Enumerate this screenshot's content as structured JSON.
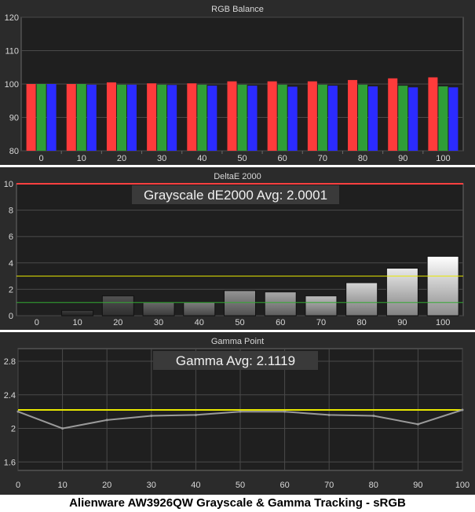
{
  "caption": "Alienware AW3926QW Grayscale & Gamma Tracking - sRGB",
  "colors": {
    "panel_bg": "#2b2b2b",
    "plot_bg": "#1f1f1f",
    "grid": "#4a4a4a",
    "text": "#d8d8d8",
    "red": "#ff3b3b",
    "green": "#2f9e37",
    "blue": "#2b2bff",
    "limit_red": "#ff4040",
    "limit_yellow": "#e8e800",
    "limit_green": "#33aa33",
    "gamma_target": "#e8e800",
    "gamma_line": "#9a9a9a"
  },
  "chart_data": [
    {
      "type": "bar",
      "title": "RGB Balance",
      "categories": [
        "0",
        "10",
        "20",
        "30",
        "40",
        "50",
        "60",
        "70",
        "80",
        "90",
        "100"
      ],
      "series": [
        {
          "values": [
            100,
            100,
            100.5,
            100.2,
            100.2,
            100.8,
            100.8,
            100.8,
            101.2,
            101.7,
            102
          ]
        },
        {
          "values": [
            100,
            100,
            99.8,
            99.8,
            99.8,
            99.8,
            99.8,
            99.8,
            99.8,
            99.5,
            99.3
          ]
        },
        {
          "values": [
            100,
            99.8,
            99.8,
            99.7,
            99.5,
            99.5,
            99.2,
            99.5,
            99.3,
            99,
            99
          ]
        }
      ],
      "ylim": [
        80,
        120
      ],
      "yticks": [
        "80",
        "90",
        "100",
        "110",
        "120"
      ]
    },
    {
      "type": "bar",
      "title": "DeltaE 2000",
      "annotation": "Grayscale dE2000 Avg: 2.0001",
      "categories": [
        "0",
        "10",
        "20",
        "30",
        "40",
        "50",
        "60",
        "70",
        "80",
        "90",
        "100"
      ],
      "values": [
        0,
        0.4,
        1.5,
        1.0,
        1.0,
        1.9,
        1.8,
        1.5,
        2.5,
        3.6,
        4.5
      ],
      "ylim": [
        0,
        10
      ],
      "yticks": [
        "0",
        "2",
        "4",
        "6",
        "8",
        "10"
      ],
      "thresholds": [
        10,
        3,
        1
      ]
    },
    {
      "type": "line",
      "title": "Gamma Point",
      "annotation": "Gamma Avg: 2.1119",
      "x": [
        0,
        10,
        20,
        30,
        40,
        50,
        60,
        70,
        80,
        90,
        100
      ],
      "y": [
        2.2,
        2.0,
        2.1,
        2.15,
        2.16,
        2.2,
        2.2,
        2.16,
        2.15,
        2.05,
        2.22
      ],
      "target": 2.22,
      "xlim": [
        0,
        100
      ],
      "ylim": [
        1.5,
        2.95
      ],
      "yticks": [
        "1.6",
        "2",
        "2.4",
        "2.8"
      ],
      "xticks": [
        "0",
        "10",
        "20",
        "30",
        "40",
        "50",
        "60",
        "70",
        "80",
        "90",
        "100"
      ]
    }
  ]
}
